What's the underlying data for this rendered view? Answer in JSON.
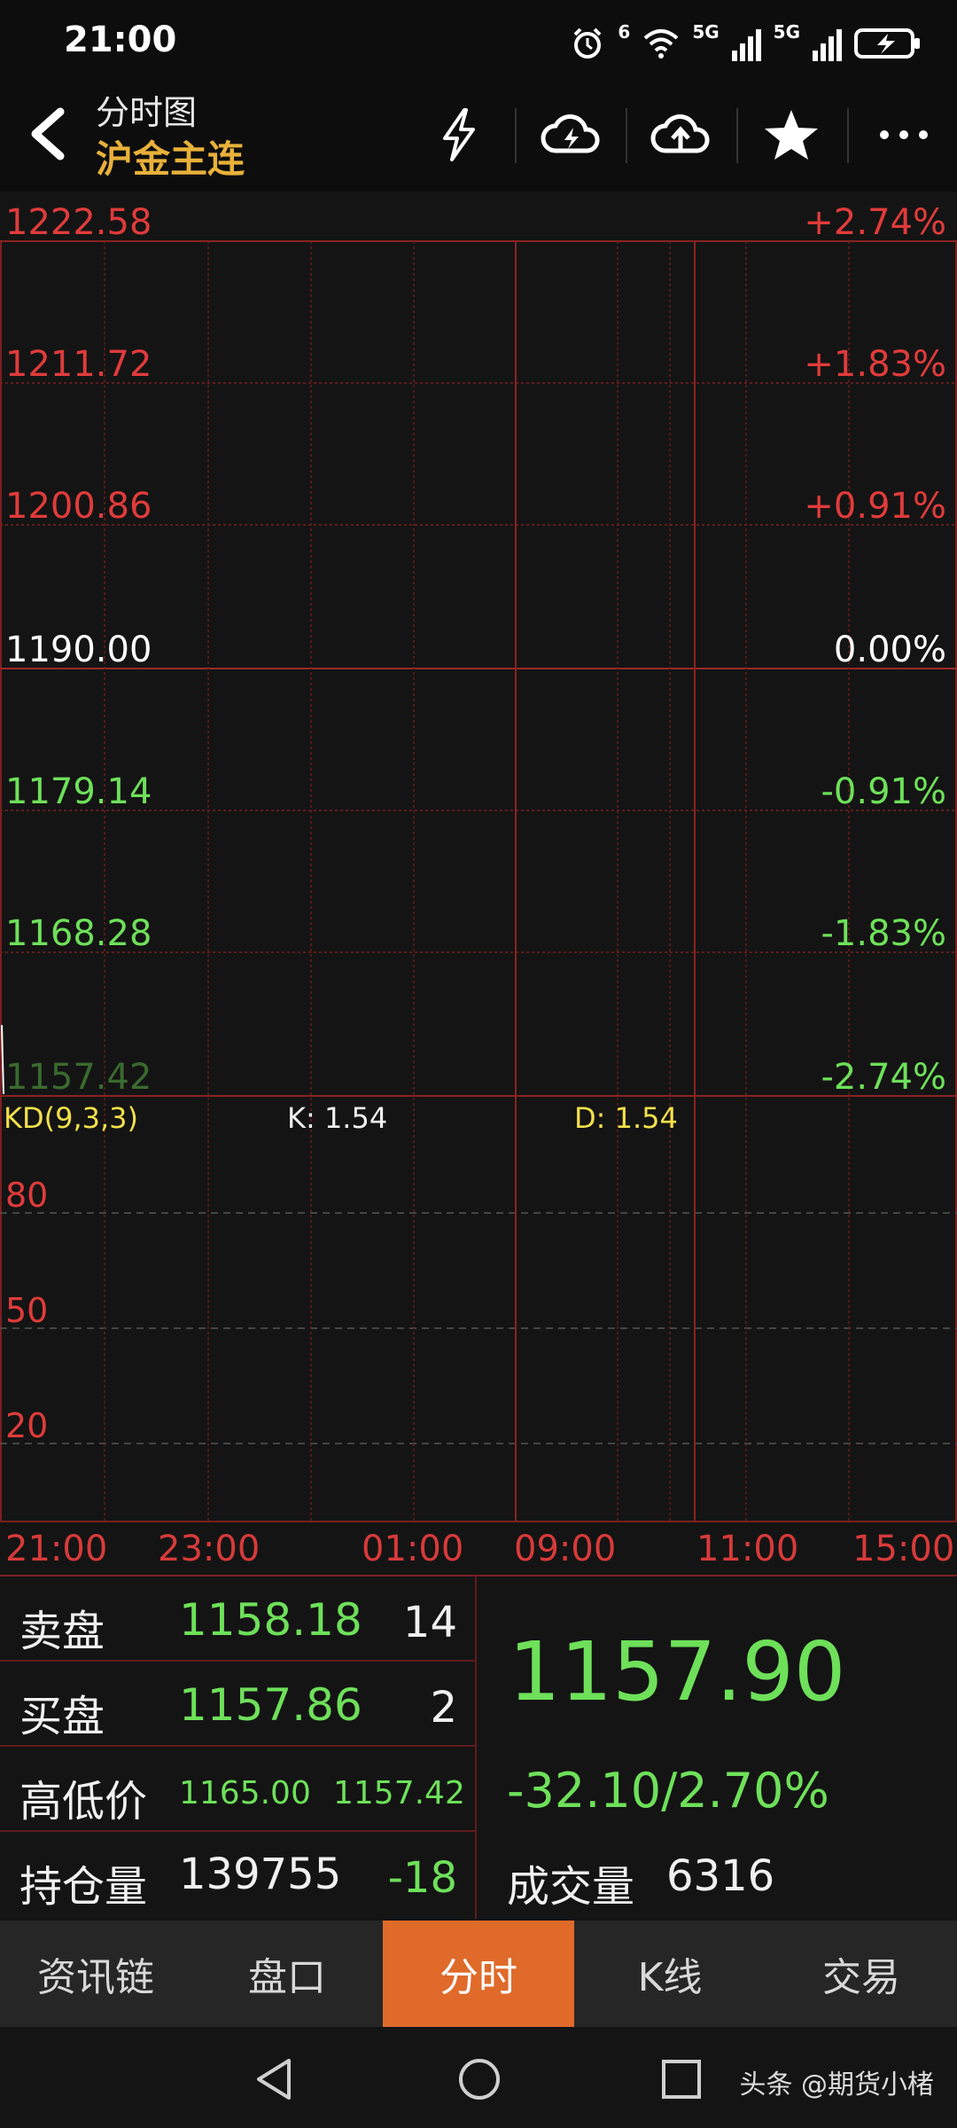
{
  "status": {
    "time": "21:00",
    "net_tag1": "5G",
    "net_tag2": "5G",
    "wifi_tag": "6"
  },
  "header": {
    "subtitle": "分时图",
    "title": "沪金主连",
    "icons": [
      "back-icon",
      "lightning-icon",
      "cloud-lightning-icon",
      "cloud-upload-icon",
      "star-icon",
      "more-icon"
    ]
  },
  "chart": {
    "price_levels": [
      {
        "price": "1222.58",
        "pct": "+2.74%",
        "color": "#e03b3b"
      },
      {
        "price": "1211.72",
        "pct": "+1.83%",
        "color": "#e03b3b"
      },
      {
        "price": "1200.86",
        "pct": "+0.91%",
        "color": "#e03b3b"
      },
      {
        "price": "1190.00",
        "pct": "0.00%",
        "color": "#ffffff"
      },
      {
        "price": "1179.14",
        "pct": "-0.91%",
        "color": "#6ee05a"
      },
      {
        "price": "1168.28",
        "pct": "-1.83%",
        "color": "#6ee05a"
      },
      {
        "price": "1157.42",
        "pct": "-2.74%",
        "color": "#6ee05a"
      }
    ],
    "indicator": {
      "name": "KD(9,3,3)",
      "k": "K: 1.54",
      "d": "D: 1.54",
      "levels": [
        "80",
        "50",
        "20"
      ]
    },
    "time_labels": [
      "21:00",
      "23:00",
      "01:00",
      "09:00",
      "11:00",
      "15:00"
    ]
  },
  "quote": {
    "ask_label": "卖盘",
    "ask_price": "1158.18",
    "ask_qty": "14",
    "bid_label": "买盘",
    "bid_price": "1157.86",
    "bid_qty": "2",
    "hl_label": "高低价",
    "high": "1165.00",
    "low": "1157.42",
    "oi_label": "持仓量",
    "oi_value": "139755",
    "oi_change": "-18",
    "last_price": "1157.90",
    "change": "-32.10/2.70%",
    "volume_label": "成交量",
    "volume_value": "6316"
  },
  "tabs": [
    {
      "label": "资讯链",
      "active": false
    },
    {
      "label": "盘口",
      "active": false
    },
    {
      "label": "分时",
      "active": true
    },
    {
      "label": "K线",
      "active": false
    },
    {
      "label": "交易",
      "active": false
    }
  ],
  "watermark": "头条 @期货小楮"
}
